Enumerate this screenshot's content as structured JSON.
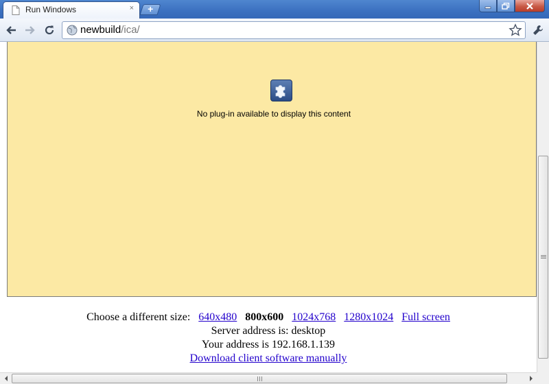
{
  "window": {
    "tab_title": "Run Windows",
    "tab_close": "×",
    "new_tab": "+"
  },
  "toolbar": {
    "url_host": "newbuild",
    "url_path": "/ica/"
  },
  "plugin": {
    "message": "No plug-in available to display this content"
  },
  "info": {
    "size_prompt": "Choose a different size:",
    "sizes": [
      {
        "label": "640x480",
        "selected": false
      },
      {
        "label": "800x600",
        "selected": true
      },
      {
        "label": "1024x768",
        "selected": false
      },
      {
        "label": "1280x1024",
        "selected": false
      },
      {
        "label": "Full screen",
        "selected": false
      }
    ],
    "server_line": "Server address is: desktop",
    "client_line": "Your address is 192.168.1.139",
    "download_link": "Download client software manually"
  },
  "colors": {
    "titlebar": "#3b70c0",
    "plugin_background": "#fce9a4",
    "link": "#2200cc"
  },
  "icons": [
    "page-icon",
    "close-tab-icon",
    "new-tab-icon",
    "minimize-icon",
    "maximize-icon",
    "close-window-icon",
    "back-arrow-icon",
    "forward-arrow-icon",
    "reload-icon",
    "globe-icon",
    "bookmark-star-icon",
    "wrench-icon",
    "puzzle-piece-icon"
  ]
}
